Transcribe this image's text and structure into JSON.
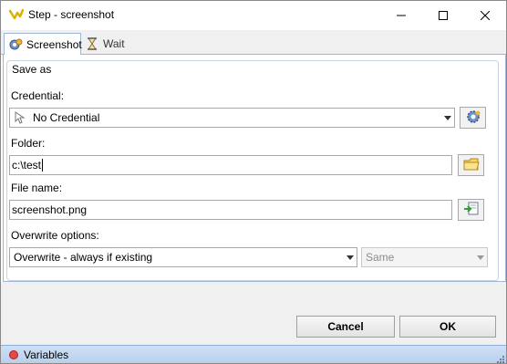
{
  "window": {
    "title": "Step - screenshot"
  },
  "tabs": [
    {
      "label": "Screenshot",
      "icon": "camera-gear-icon",
      "active": true
    },
    {
      "label": "Wait",
      "icon": "hourglass-icon",
      "active": false
    }
  ],
  "group": {
    "legend": "Save as"
  },
  "credential": {
    "label": "Credential:",
    "value": "No Credential",
    "icon": "cursor-icon",
    "button_icon": "gear-icon"
  },
  "folder": {
    "label": "Folder:",
    "value": "c:\\test",
    "button_icon": "folder-icon"
  },
  "filename": {
    "label": "File name:",
    "value": "screenshot.png",
    "button_icon": "insert-variable-icon"
  },
  "overwrite": {
    "label": "Overwrite options:",
    "value": "Overwrite - always if existing",
    "secondary_value": "Same"
  },
  "buttons": {
    "cancel": "Cancel",
    "ok": "OK"
  },
  "statusbar": {
    "label": "Variables"
  },
  "colors": {
    "accent_border": "#9fb6d6",
    "statusbar": "#c5d9f1",
    "status_dot": "#e24a4a"
  }
}
